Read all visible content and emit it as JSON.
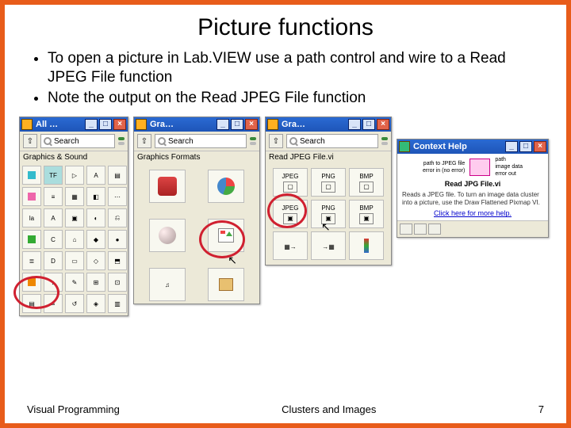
{
  "title": "Picture functions",
  "bullets": [
    "To open a picture in Lab.VIEW use a path control and wire to a Read JPEG File function",
    "Note the output on the Read JPEG File function"
  ],
  "palette_all": {
    "title": "All …",
    "search_label": "Search",
    "subheader": "Graphics & Sound"
  },
  "palette_gra1": {
    "title": "Gra…",
    "search_label": "Search",
    "subheader": "Graphics Formats"
  },
  "palette_gra2": {
    "title": "Gra…",
    "search_label": "Search",
    "subheader": "Read JPEG File.vi",
    "formats_row1": [
      "JPEG",
      "PNG",
      "BMP"
    ],
    "formats_row2": [
      "JPEG",
      "PNG",
      "BMP"
    ]
  },
  "context_help": {
    "title": "Context Help",
    "left_label": "path to JPEG file",
    "right_top": "path",
    "right_bottom": "image data",
    "error_in": "error in (no error)",
    "error_out": "error out",
    "subtitle": "Read JPG File.vi",
    "description": "Reads a JPEG file. To turn an image data cluster into a picture, use the Draw Flattened Pixmap VI.",
    "link": "Click here for more help."
  },
  "footer": {
    "left": "Visual Programming",
    "center": "Clusters and Images",
    "right": "7"
  }
}
